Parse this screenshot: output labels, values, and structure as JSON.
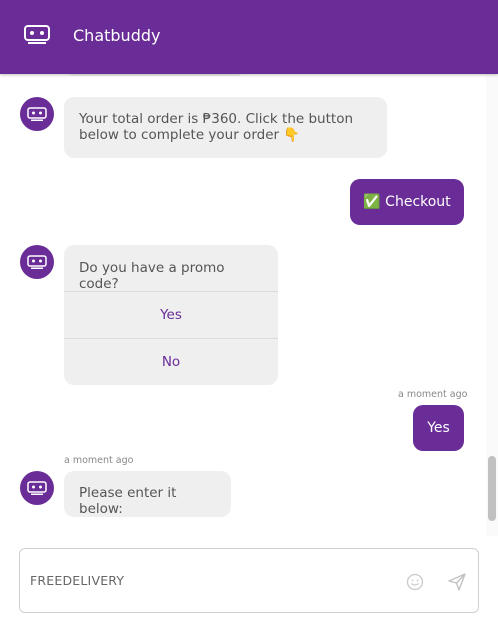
{
  "app": {
    "title": "Chatbuddy",
    "accent_color": "#6a2c96"
  },
  "messages": {
    "order_total": "Your total order is ₱360. Click the button below to complete your order 👇",
    "checkout_label": "✅ Checkout",
    "promo_question": "Do you have a promo code?",
    "quick_replies": [
      "Yes",
      "No"
    ],
    "user_reply_time": "a moment ago",
    "user_reply": "Yes",
    "bot_time": "a moment ago",
    "bot_prompt": "Please enter it below:"
  },
  "composer": {
    "value": "FREEDELIVERY",
    "emoji_icon": "smiley-icon",
    "send_icon": "send-icon"
  }
}
